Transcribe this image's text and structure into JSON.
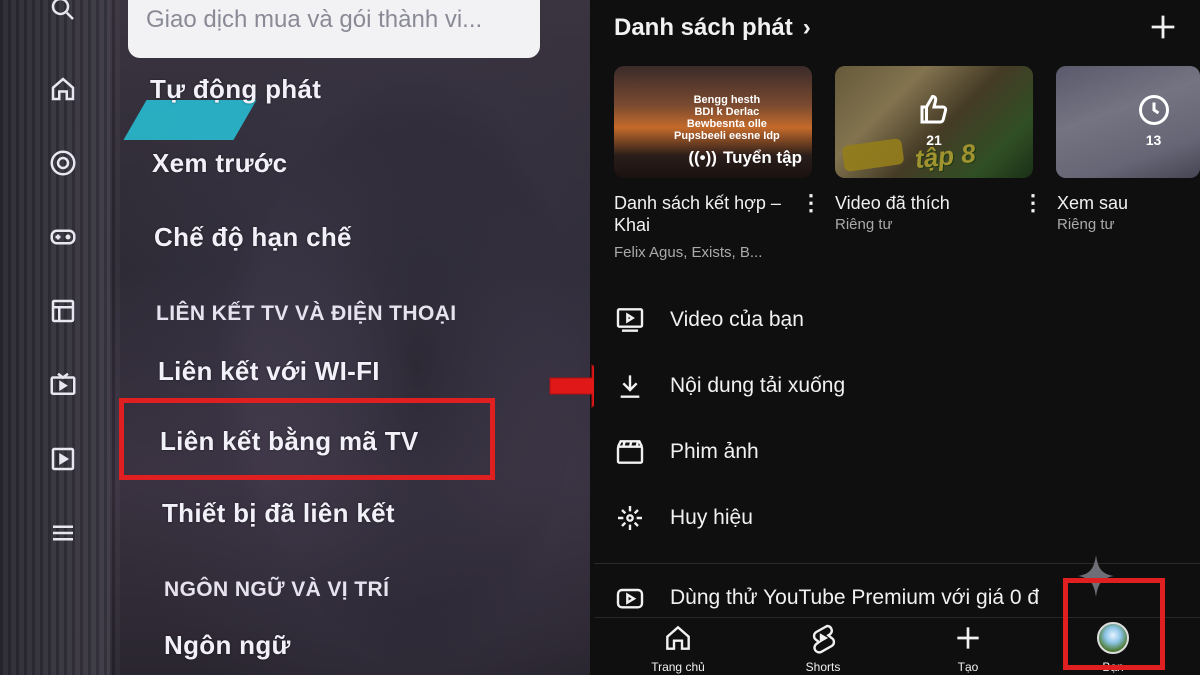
{
  "tv": {
    "search_text": "Giao dịch mua và gói thành vi...",
    "rail_icons": [
      "search-icon",
      "home-icon",
      "subscriptions-icon",
      "gaming-icon",
      "library-icon",
      "tv-icon",
      "playlist-icon",
      "menu-icon"
    ],
    "items": {
      "autoplay": "Tự động phát",
      "preview": "Xem trước",
      "restricted": "Chế độ hạn chế",
      "section_link": "LIÊN KẾT TV VÀ ĐIỆN THOẠI",
      "link_wifi": "Liên kết với WI-FI",
      "link_code": "Liên kết bằng mã TV",
      "linked_devices": "Thiết bị đã liên kết",
      "section_lang": "NGÔN NGỮ VÀ VỊ TRÍ",
      "language": "Ngôn ngữ"
    }
  },
  "app": {
    "playlists_header": "Danh sách phát",
    "playlists": [
      {
        "title": "Danh sách kết hợp – Khai",
        "subtitle": "Felix Agus, Exists, B...",
        "badge": "Tuyển tập"
      },
      {
        "title": "Video đã thích",
        "subtitle": "Riêng tư",
        "count": "21",
        "thumb_text": "tập 8"
      },
      {
        "title": "Xem sau",
        "subtitle": "Riêng tư",
        "count": "13"
      }
    ],
    "thumb1_caption": "Bengg hesth\nBDI k Derlac\nBewbesnta olle\nPupsbeeli eesne Idp",
    "menu": {
      "your_videos": "Video của bạn",
      "downloads": "Nội dung tải xuống",
      "movies": "Phim ảnh",
      "badges": "Huy hiệu",
      "premium": "Dùng thử YouTube Premium với giá 0 đ"
    },
    "nav": {
      "home": "Trang chủ",
      "shorts": "Shorts",
      "create": "Tạo",
      "you": "Bạn"
    }
  },
  "colors": {
    "highlight": "#e02020",
    "app_bg": "#0f0f0f",
    "text_secondary": "#aaaaaa"
  }
}
